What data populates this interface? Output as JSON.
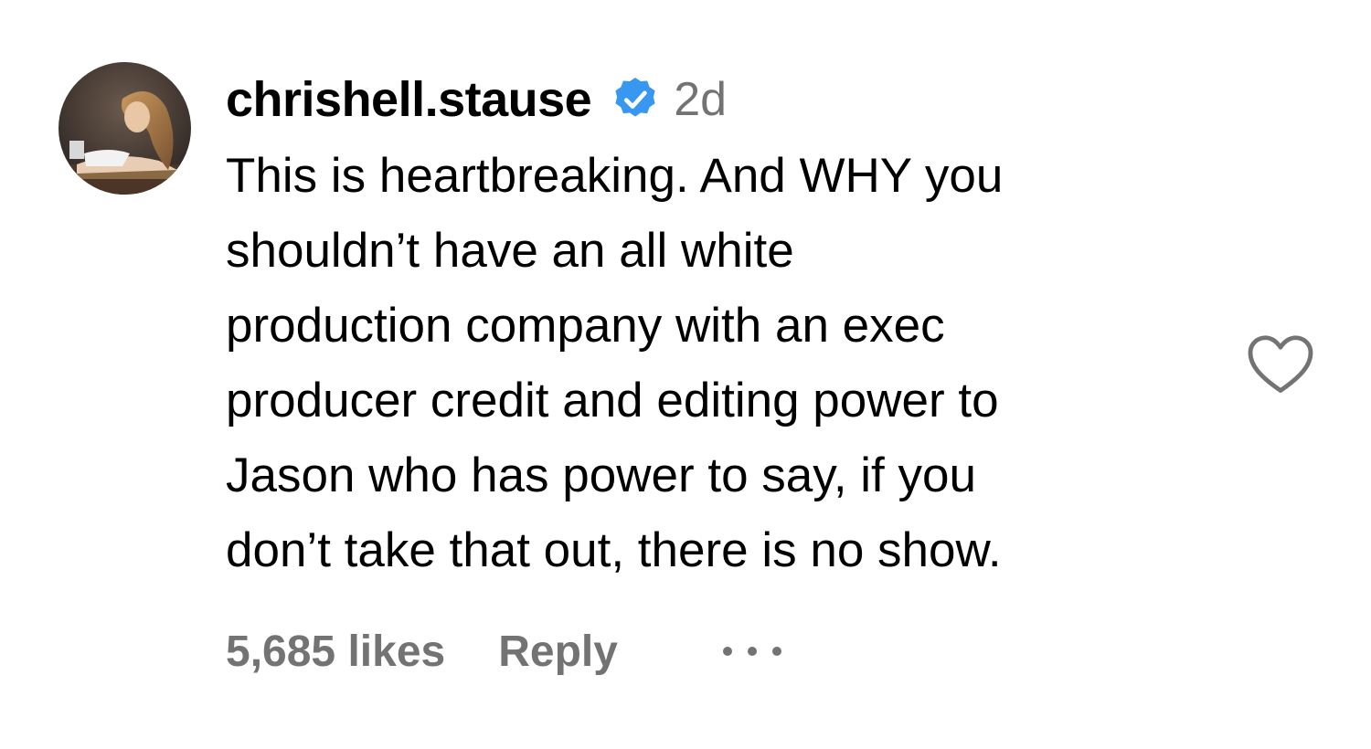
{
  "comment": {
    "username": "chrishell.stause",
    "verified": true,
    "time_ago": "2d",
    "text_lines": [
      "This is heartbreaking. And WHY you",
      "shouldn’t have an all white",
      "production company with an exec",
      "producer credit and editing power to",
      "Jason who has power to say, if you",
      "don’t take that out, there is no show."
    ],
    "likes_label": "5,685 likes",
    "reply_label": "Reply"
  },
  "icons": {
    "verified": "verified-badge-icon",
    "like": "heart-outline-icon",
    "more": "more-options-icon"
  },
  "colors": {
    "verified_blue": "#3897f0",
    "secondary_text": "#737373"
  }
}
